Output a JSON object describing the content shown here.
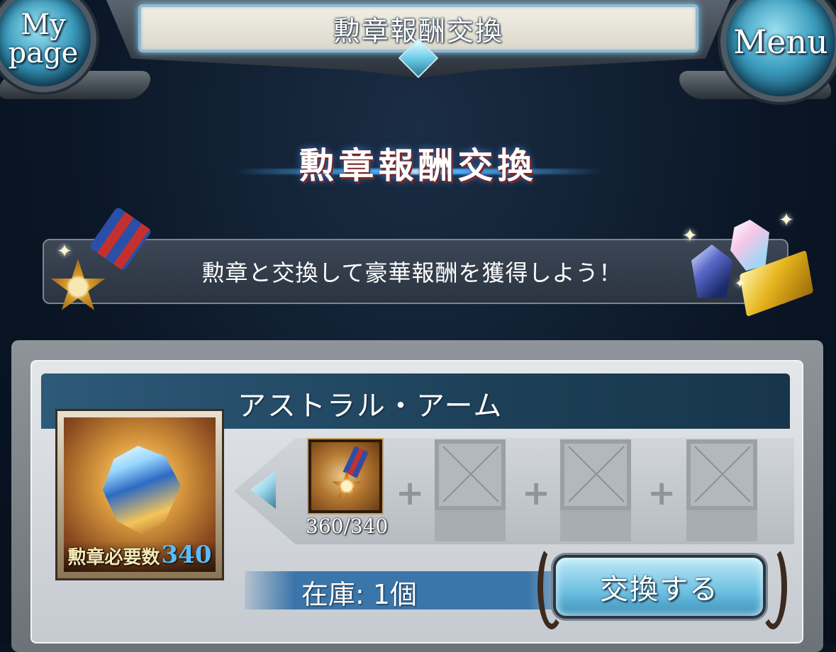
{
  "header": {
    "title": "勲章報酬交換",
    "mypage_label": "My page",
    "menu_label": "Menu"
  },
  "section": {
    "heading": "勲章報酬交換"
  },
  "banner": {
    "text": "勲章と交換して豪華報酬を獲得しよう！"
  },
  "item": {
    "name": "アストラル・アーム",
    "required_label": "勲章必要数",
    "required_count": "340",
    "owned_progress": "360/340",
    "stock_label": "在庫: 1個"
  },
  "actions": {
    "exchange_label": "交換する"
  },
  "colors": {
    "accent": "#6bbfe0",
    "title_bar": "#1d4058",
    "required_count": "#5bbcff"
  }
}
